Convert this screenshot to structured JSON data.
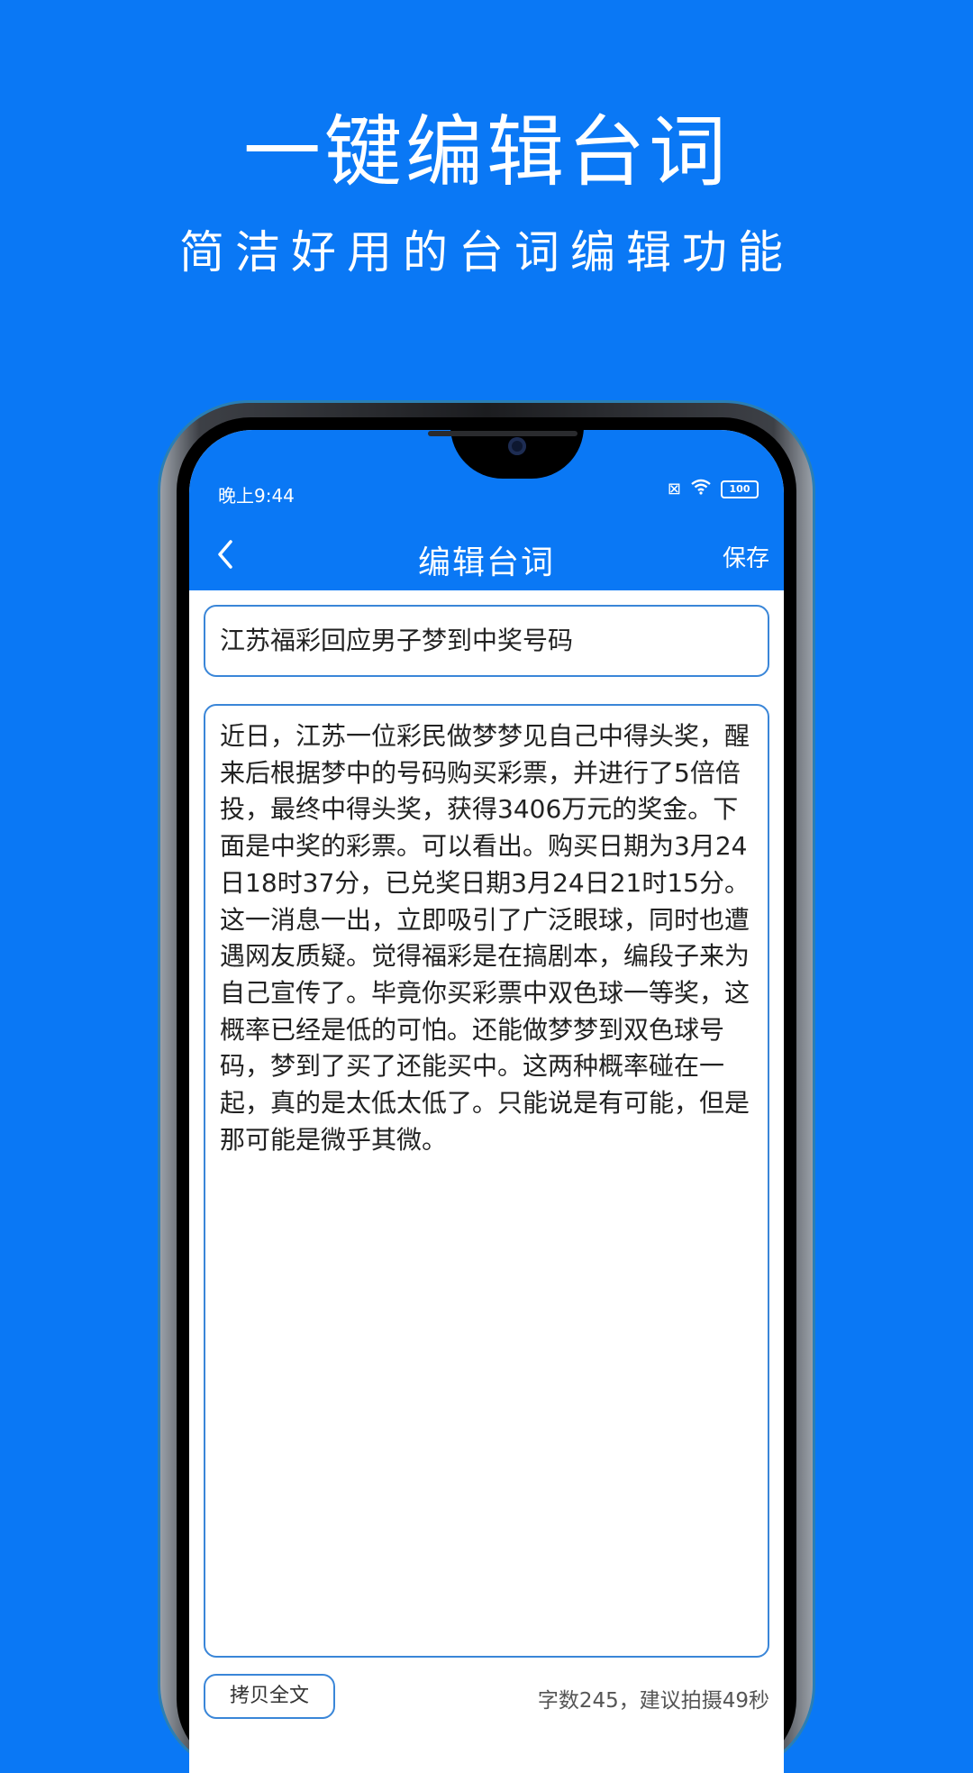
{
  "promo": {
    "title": "一键编辑台词",
    "subtitle": "简洁好用的台词编辑功能"
  },
  "status_bar": {
    "time": "晚上9:44",
    "battery": "100"
  },
  "navbar": {
    "back_icon": "chevron-left-icon",
    "title": "编辑台词",
    "save_label": "保存"
  },
  "editor": {
    "title_value": "江苏福彩回应男子梦到中奖号码",
    "body_value": "近日，江苏一位彩民做梦梦见自己中得头奖，醒来后根据梦中的号码购买彩票，并进行了5倍倍投，最终中得头奖，获得3406万元的奖金。下面是中奖的彩票。可以看出。购买日期为3月24日18时37分，已兑奖日期3月24日21时15分。\n这一消息一出，立即吸引了广泛眼球，同时也遭遇网友质疑。觉得福彩是在搞剧本，编段子来为自己宣传了。毕竟你买彩票中双色球一等奖，这概率已经是低的可怕。还能做梦梦到双色球号码，梦到了买了还能买中。这两种概率碰在一起，真的是太低太低了。只能说是有可能，但是那可能是微乎其微。"
  },
  "footer": {
    "copy_label": "拷贝全文",
    "word_count": "字数245，建议拍摄49秒"
  },
  "colors": {
    "brand_blue": "#0a78f5",
    "field_border": "#3a86d8"
  }
}
